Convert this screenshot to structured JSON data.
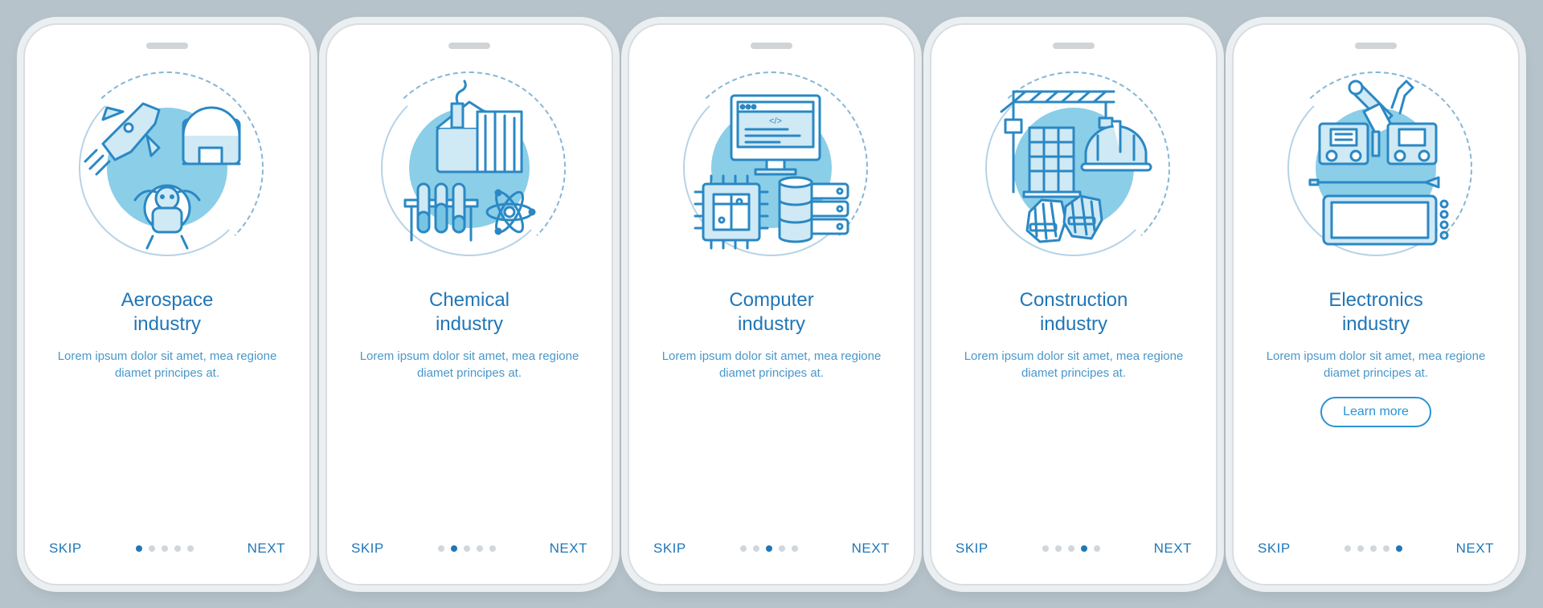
{
  "screens": [
    {
      "title": "Aerospace\nindustry",
      "desc": "Lorem ipsum dolor sit amet, mea regione diamet principes at.",
      "skip": "SKIP",
      "next": "NEXT",
      "active_dot": 0,
      "has_button": false,
      "icon": "aerospace"
    },
    {
      "title": "Chemical\nindustry",
      "desc": "Lorem ipsum dolor sit amet, mea regione diamet principes at.",
      "skip": "SKIP",
      "next": "NEXT",
      "active_dot": 1,
      "has_button": false,
      "icon": "chemical"
    },
    {
      "title": "Computer\nindustry",
      "desc": "Lorem ipsum dolor sit amet, mea regione diamet principes at.",
      "skip": "SKIP",
      "next": "NEXT",
      "active_dot": 2,
      "has_button": false,
      "icon": "computer"
    },
    {
      "title": "Construction\nindustry",
      "desc": "Lorem ipsum dolor sit amet, mea regione diamet principes at.",
      "skip": "SKIP",
      "next": "NEXT",
      "active_dot": 3,
      "has_button": false,
      "icon": "construction"
    },
    {
      "title": "Electronics\nindustry",
      "desc": "Lorem ipsum dolor sit amet, mea regione diamet principes at.",
      "skip": "SKIP",
      "next": "NEXT",
      "active_dot": 4,
      "has_button": true,
      "button_label": "Learn more",
      "icon": "electronics"
    }
  ],
  "colors": {
    "primary": "#2176b6",
    "accent": "#77c5e4",
    "bg": "#b6c3ca"
  },
  "dot_count": 5
}
